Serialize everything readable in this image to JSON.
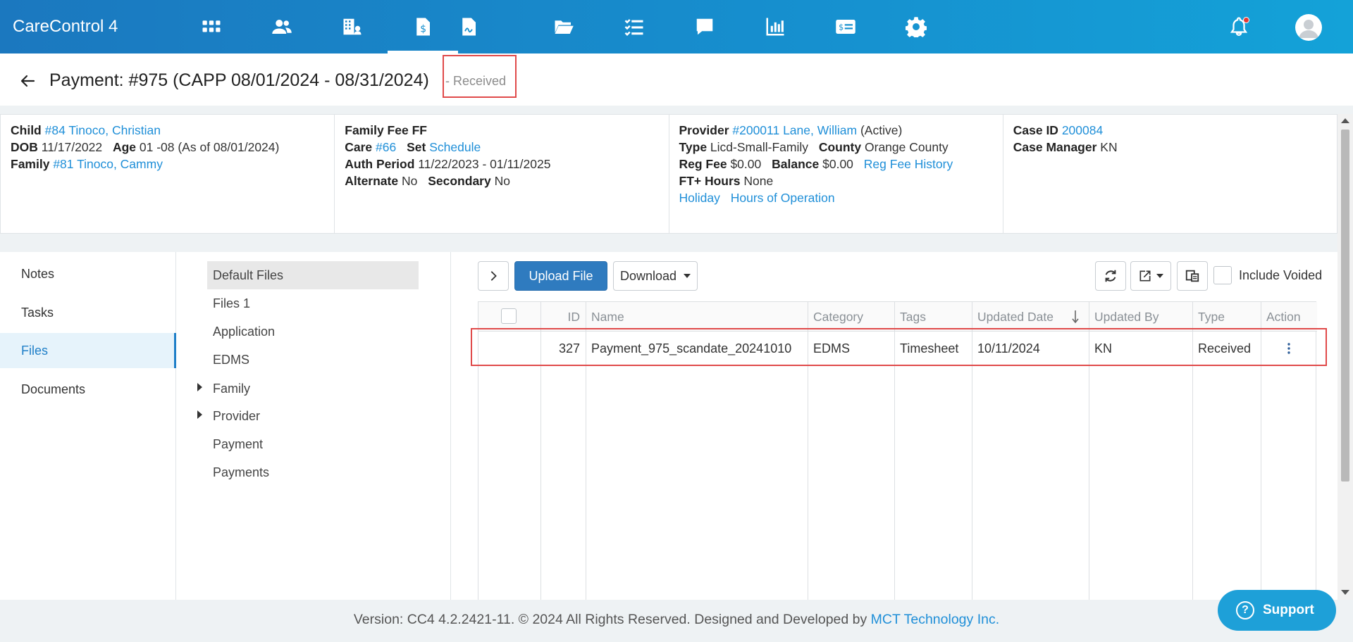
{
  "app": {
    "title": "CareControl 4"
  },
  "nav": {
    "icons": [
      "apps-grid-icon",
      "people-icon",
      "building-icon",
      "invoice-dollar-icon",
      "document-signature-icon",
      "folder-open-icon",
      "checklist-icon",
      "chat-icon",
      "bar-chart-icon",
      "id-card-icon",
      "gear-icon"
    ]
  },
  "page": {
    "title": "Payment: #975 (CAPP 08/01/2024 - 08/31/2024)",
    "status": "- Received"
  },
  "info": {
    "col1": {
      "child_label": "Child",
      "child_value": "#84 Tinoco, Christian",
      "dob_label": "DOB",
      "dob_value": "11/17/2022",
      "age_label": "Age",
      "age_value": "01 -08 (As of 08/01/2024)",
      "family_label": "Family",
      "family_value": "#81 Tinoco, Cammy"
    },
    "col2": {
      "family_fee_label": "Family Fee",
      "family_fee_value": "FF",
      "care_label": "Care",
      "care_value": "#66",
      "set_label": "Set",
      "set_value": "Schedule",
      "auth_label": "Auth Period",
      "auth_value": "11/22/2023 - 01/11/2025",
      "alternate_label": "Alternate",
      "alternate_value": "No",
      "secondary_label": "Secondary",
      "secondary_value": "No"
    },
    "col3": {
      "provider_label": "Provider",
      "provider_value": "#200011 Lane, William",
      "provider_status": "(Active)",
      "type_label": "Type",
      "type_value": "Licd-Small-Family",
      "county_label": "County",
      "county_value": "Orange County",
      "reg_fee_label": "Reg Fee",
      "reg_fee_value": "$0.00",
      "balance_label": "Balance",
      "balance_value": "$0.00",
      "reg_fee_history": "Reg Fee History",
      "ft_label": "FT+ Hours",
      "ft_value": "None",
      "holiday": "Holiday",
      "hours_of_operation": "Hours of Operation"
    },
    "col4": {
      "case_id_label": "Case ID",
      "case_id_value": "200084",
      "case_manager_label": "Case Manager",
      "case_manager_value": "KN"
    }
  },
  "leftnav": [
    "Notes",
    "Tasks",
    "Files",
    "Documents"
  ],
  "folders": [
    "Default Files",
    "Files 1",
    "Application",
    "EDMS",
    "Family",
    "Provider",
    "Payment",
    "Payments"
  ],
  "toolbar": {
    "upload": "Upload File",
    "download": "Download",
    "include_voided": "Include Voided"
  },
  "table": {
    "columns": [
      "ID",
      "Name",
      "Category",
      "Tags",
      "Updated Date",
      "Updated By",
      "Type",
      "Action"
    ],
    "rows": [
      {
        "id": "327",
        "name": "Payment_975_scandate_20241010",
        "category": "EDMS",
        "tags": "Timesheet",
        "updated_date": "10/11/2024",
        "updated_by": "KN",
        "type": "Received"
      }
    ]
  },
  "footer": {
    "text": "Version: CC4 4.2.2421-11. © 2024 All Rights Reserved. Designed and Developed by",
    "company": "MCT Technology Inc."
  },
  "support": {
    "label": "Support"
  }
}
